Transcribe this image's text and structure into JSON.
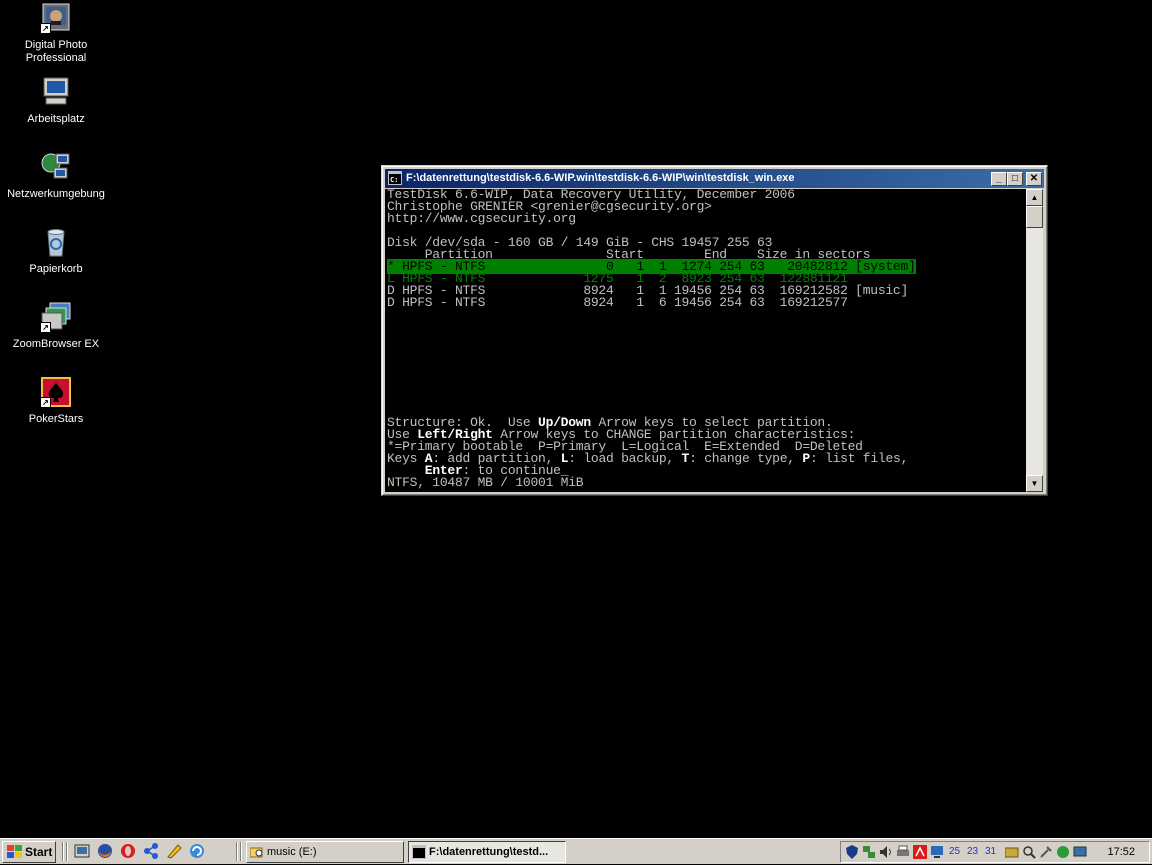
{
  "desktop": {
    "icons": [
      {
        "label": "Digital Photo Professional",
        "icon": "photo-app-icon"
      },
      {
        "label": "Arbeitsplatz",
        "icon": "computer-icon"
      },
      {
        "label": "Netzwerkumgebung",
        "icon": "network-icon"
      },
      {
        "label": "Papierkorb",
        "icon": "recycle-bin-icon"
      },
      {
        "label": "ZoomBrowser EX",
        "icon": "zoombrowser-icon"
      },
      {
        "label": "PokerStars",
        "icon": "pokerstars-icon"
      }
    ]
  },
  "window": {
    "title": "F:\\datenrettung\\testdisk-6.6-WIP.win\\testdisk-6.6-WIP\\win\\testdisk_win.exe",
    "console": {
      "header1": "TestDisk 6.6-WIP, Data Recovery Utility, December 2006",
      "header2": "Christophe GRENIER <grenier@cgsecurity.org>",
      "header3": "http://www.cgsecurity.org",
      "disk": "Disk /dev/sda - 160 GB / 149 GiB - CHS 19457 255 63",
      "columns": "     Partition               Start        End    Size in sectors",
      "rows": [
        "* HPFS - NTFS                0   1  1  1274 254 63   20482812 [system]",
        "L HPFS - NTFS             1275   1  2  8923 254 63  122881121",
        "D HPFS - NTFS             8924   1  1 19456 254 63  169212582 [music]",
        "D HPFS - NTFS             8924   1  6 19456 254 63  169212577"
      ],
      "footer": {
        "l1a": "Structure: Ok.  Use ",
        "l1b": "Up/Down",
        "l1c": " Arrow keys to select partition.",
        "l2a": "Use ",
        "l2b": "Left/Right",
        "l2c": " Arrow keys to CHANGE partition characteristics:",
        "l3": "*=Primary bootable  P=Primary  L=Logical  E=Extended  D=Deleted",
        "l4a": "Keys ",
        "l4b": "A",
        "l4c": ": add partition, ",
        "l4d": "L",
        "l4e": ": load backup, ",
        "l4f": "T",
        "l4g": ": change type, ",
        "l4h": "P",
        "l4i": ": list files,",
        "l5a": "     ",
        "l5b": "Enter",
        "l5c": ": to continue_",
        "l6": "NTFS, 10487 MB / 10001 MiB"
      }
    }
  },
  "taskbar": {
    "start_label": "Start",
    "tasks": [
      {
        "label": "music (E:)",
        "active": false
      },
      {
        "label": "F:\\datenrettung\\testd...",
        "active": true
      }
    ],
    "tray_numbers": [
      "25",
      "23",
      "31"
    ],
    "clock": "17:52"
  }
}
